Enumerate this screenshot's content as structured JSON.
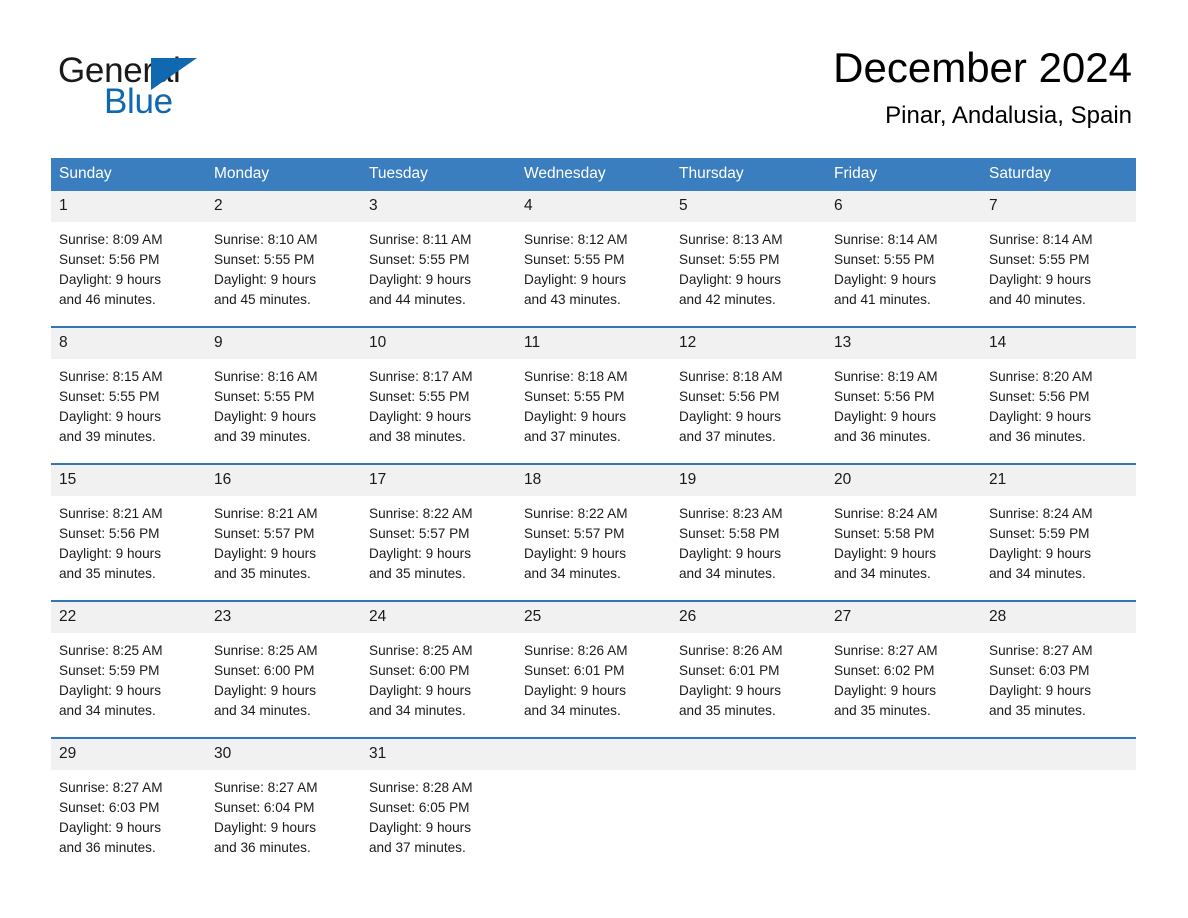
{
  "brand": {
    "name_part1": "General",
    "name_part2": "Blue",
    "accent_color": "#1068b0"
  },
  "header": {
    "title": "December 2024",
    "subtitle": "Pinar, Andalusia, Spain"
  },
  "calendar": {
    "header_bg_color": "#3a7ebf",
    "daynum_bg_color": "#f1f1f1",
    "row_divider_color": "#2f77b8",
    "weekday_headers": [
      "Sunday",
      "Monday",
      "Tuesday",
      "Wednesday",
      "Thursday",
      "Friday",
      "Saturday"
    ],
    "weeks": [
      [
        {
          "day": "1",
          "sunrise": "Sunrise: 8:09 AM",
          "sunset": "Sunset: 5:56 PM",
          "daylight_line1": "Daylight: 9 hours",
          "daylight_line2": "and 46 minutes."
        },
        {
          "day": "2",
          "sunrise": "Sunrise: 8:10 AM",
          "sunset": "Sunset: 5:55 PM",
          "daylight_line1": "Daylight: 9 hours",
          "daylight_line2": "and 45 minutes."
        },
        {
          "day": "3",
          "sunrise": "Sunrise: 8:11 AM",
          "sunset": "Sunset: 5:55 PM",
          "daylight_line1": "Daylight: 9 hours",
          "daylight_line2": "and 44 minutes."
        },
        {
          "day": "4",
          "sunrise": "Sunrise: 8:12 AM",
          "sunset": "Sunset: 5:55 PM",
          "daylight_line1": "Daylight: 9 hours",
          "daylight_line2": "and 43 minutes."
        },
        {
          "day": "5",
          "sunrise": "Sunrise: 8:13 AM",
          "sunset": "Sunset: 5:55 PM",
          "daylight_line1": "Daylight: 9 hours",
          "daylight_line2": "and 42 minutes."
        },
        {
          "day": "6",
          "sunrise": "Sunrise: 8:14 AM",
          "sunset": "Sunset: 5:55 PM",
          "daylight_line1": "Daylight: 9 hours",
          "daylight_line2": "and 41 minutes."
        },
        {
          "day": "7",
          "sunrise": "Sunrise: 8:14 AM",
          "sunset": "Sunset: 5:55 PM",
          "daylight_line1": "Daylight: 9 hours",
          "daylight_line2": "and 40 minutes."
        }
      ],
      [
        {
          "day": "8",
          "sunrise": "Sunrise: 8:15 AM",
          "sunset": "Sunset: 5:55 PM",
          "daylight_line1": "Daylight: 9 hours",
          "daylight_line2": "and 39 minutes."
        },
        {
          "day": "9",
          "sunrise": "Sunrise: 8:16 AM",
          "sunset": "Sunset: 5:55 PM",
          "daylight_line1": "Daylight: 9 hours",
          "daylight_line2": "and 39 minutes."
        },
        {
          "day": "10",
          "sunrise": "Sunrise: 8:17 AM",
          "sunset": "Sunset: 5:55 PM",
          "daylight_line1": "Daylight: 9 hours",
          "daylight_line2": "and 38 minutes."
        },
        {
          "day": "11",
          "sunrise": "Sunrise: 8:18 AM",
          "sunset": "Sunset: 5:55 PM",
          "daylight_line1": "Daylight: 9 hours",
          "daylight_line2": "and 37 minutes."
        },
        {
          "day": "12",
          "sunrise": "Sunrise: 8:18 AM",
          "sunset": "Sunset: 5:56 PM",
          "daylight_line1": "Daylight: 9 hours",
          "daylight_line2": "and 37 minutes."
        },
        {
          "day": "13",
          "sunrise": "Sunrise: 8:19 AM",
          "sunset": "Sunset: 5:56 PM",
          "daylight_line1": "Daylight: 9 hours",
          "daylight_line2": "and 36 minutes."
        },
        {
          "day": "14",
          "sunrise": "Sunrise: 8:20 AM",
          "sunset": "Sunset: 5:56 PM",
          "daylight_line1": "Daylight: 9 hours",
          "daylight_line2": "and 36 minutes."
        }
      ],
      [
        {
          "day": "15",
          "sunrise": "Sunrise: 8:21 AM",
          "sunset": "Sunset: 5:56 PM",
          "daylight_line1": "Daylight: 9 hours",
          "daylight_line2": "and 35 minutes."
        },
        {
          "day": "16",
          "sunrise": "Sunrise: 8:21 AM",
          "sunset": "Sunset: 5:57 PM",
          "daylight_line1": "Daylight: 9 hours",
          "daylight_line2": "and 35 minutes."
        },
        {
          "day": "17",
          "sunrise": "Sunrise: 8:22 AM",
          "sunset": "Sunset: 5:57 PM",
          "daylight_line1": "Daylight: 9 hours",
          "daylight_line2": "and 35 minutes."
        },
        {
          "day": "18",
          "sunrise": "Sunrise: 8:22 AM",
          "sunset": "Sunset: 5:57 PM",
          "daylight_line1": "Daylight: 9 hours",
          "daylight_line2": "and 34 minutes."
        },
        {
          "day": "19",
          "sunrise": "Sunrise: 8:23 AM",
          "sunset": "Sunset: 5:58 PM",
          "daylight_line1": "Daylight: 9 hours",
          "daylight_line2": "and 34 minutes."
        },
        {
          "day": "20",
          "sunrise": "Sunrise: 8:24 AM",
          "sunset": "Sunset: 5:58 PM",
          "daylight_line1": "Daylight: 9 hours",
          "daylight_line2": "and 34 minutes."
        },
        {
          "day": "21",
          "sunrise": "Sunrise: 8:24 AM",
          "sunset": "Sunset: 5:59 PM",
          "daylight_line1": "Daylight: 9 hours",
          "daylight_line2": "and 34 minutes."
        }
      ],
      [
        {
          "day": "22",
          "sunrise": "Sunrise: 8:25 AM",
          "sunset": "Sunset: 5:59 PM",
          "daylight_line1": "Daylight: 9 hours",
          "daylight_line2": "and 34 minutes."
        },
        {
          "day": "23",
          "sunrise": "Sunrise: 8:25 AM",
          "sunset": "Sunset: 6:00 PM",
          "daylight_line1": "Daylight: 9 hours",
          "daylight_line2": "and 34 minutes."
        },
        {
          "day": "24",
          "sunrise": "Sunrise: 8:25 AM",
          "sunset": "Sunset: 6:00 PM",
          "daylight_line1": "Daylight: 9 hours",
          "daylight_line2": "and 34 minutes."
        },
        {
          "day": "25",
          "sunrise": "Sunrise: 8:26 AM",
          "sunset": "Sunset: 6:01 PM",
          "daylight_line1": "Daylight: 9 hours",
          "daylight_line2": "and 34 minutes."
        },
        {
          "day": "26",
          "sunrise": "Sunrise: 8:26 AM",
          "sunset": "Sunset: 6:01 PM",
          "daylight_line1": "Daylight: 9 hours",
          "daylight_line2": "and 35 minutes."
        },
        {
          "day": "27",
          "sunrise": "Sunrise: 8:27 AM",
          "sunset": "Sunset: 6:02 PM",
          "daylight_line1": "Daylight: 9 hours",
          "daylight_line2": "and 35 minutes."
        },
        {
          "day": "28",
          "sunrise": "Sunrise: 8:27 AM",
          "sunset": "Sunset: 6:03 PM",
          "daylight_line1": "Daylight: 9 hours",
          "daylight_line2": "and 35 minutes."
        }
      ],
      [
        {
          "day": "29",
          "sunrise": "Sunrise: 8:27 AM",
          "sunset": "Sunset: 6:03 PM",
          "daylight_line1": "Daylight: 9 hours",
          "daylight_line2": "and 36 minutes."
        },
        {
          "day": "30",
          "sunrise": "Sunrise: 8:27 AM",
          "sunset": "Sunset: 6:04 PM",
          "daylight_line1": "Daylight: 9 hours",
          "daylight_line2": "and 36 minutes."
        },
        {
          "day": "31",
          "sunrise": "Sunrise: 8:28 AM",
          "sunset": "Sunset: 6:05 PM",
          "daylight_line1": "Daylight: 9 hours",
          "daylight_line2": "and 37 minutes."
        },
        {
          "day": "",
          "sunrise": "",
          "sunset": "",
          "daylight_line1": "",
          "daylight_line2": ""
        },
        {
          "day": "",
          "sunrise": "",
          "sunset": "",
          "daylight_line1": "",
          "daylight_line2": ""
        },
        {
          "day": "",
          "sunrise": "",
          "sunset": "",
          "daylight_line1": "",
          "daylight_line2": ""
        },
        {
          "day": "",
          "sunrise": "",
          "sunset": "",
          "daylight_line1": "",
          "daylight_line2": ""
        }
      ]
    ]
  }
}
